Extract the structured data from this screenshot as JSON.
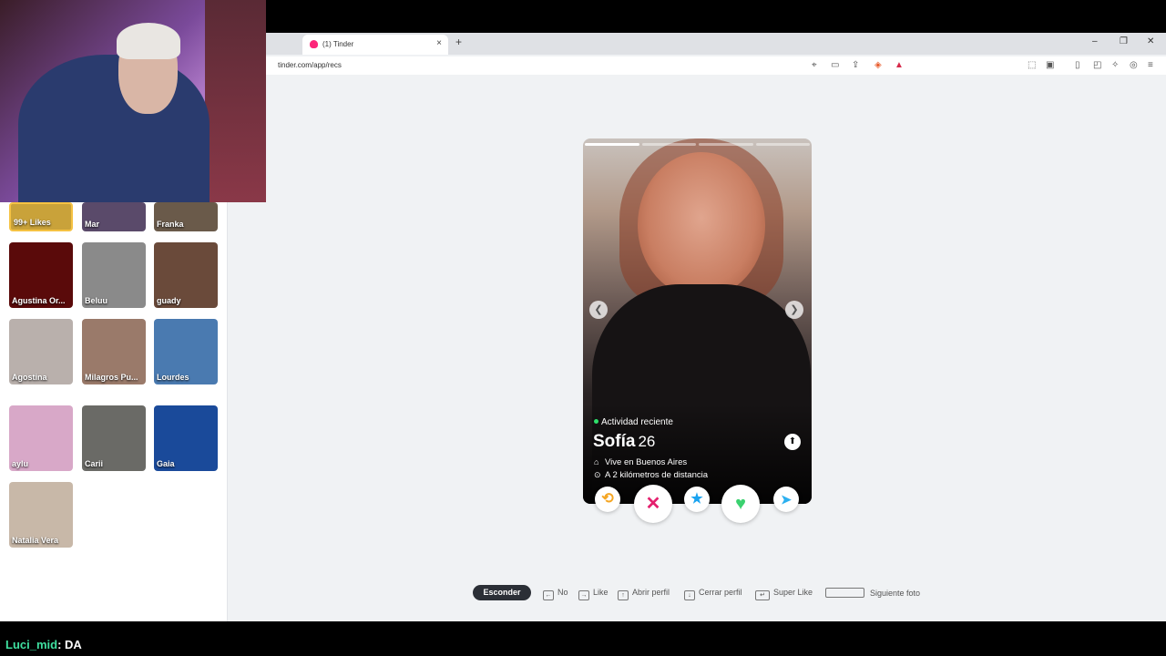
{
  "browser": {
    "tab_title": "(1) Tinder",
    "tab_close": "×",
    "new_tab": "+",
    "url": "tinder.com/app/recs",
    "window_controls": [
      "–",
      "❐",
      "✕"
    ]
  },
  "sidebar": {
    "items": [
      {
        "label": "99+ Likes",
        "color": "#c9a23a"
      },
      {
        "label": "Mar",
        "color": "#5a4a6a"
      },
      {
        "label": "Franka",
        "color": "#6a5a4a"
      },
      {
        "label": "Agustina Or...",
        "color": "#5a0a0a"
      },
      {
        "label": "Beluu",
        "color": "#8a8a8a"
      },
      {
        "label": "guady",
        "color": "#6a4a3a"
      },
      {
        "label": "Agostina",
        "color": "#b9b0ac"
      },
      {
        "label": "Milagros Pu...",
        "color": "#9a7a6a"
      },
      {
        "label": "Lourdes",
        "color": "#4a7ab0"
      },
      {
        "label": "aylu",
        "color": "#d8a8c8"
      },
      {
        "label": "Carii",
        "color": "#6a6a66"
      },
      {
        "label": "Gaia",
        "color": "#1a4a9a"
      },
      {
        "label": "Natalia Vera",
        "color": "#c8b8a8"
      }
    ]
  },
  "card": {
    "activity": "Actividad reciente",
    "name": "Sofía",
    "age": "26",
    "location": "Vive en Buenos Aires",
    "distance": "A 2 kilómetros de distancia",
    "photo_index": 1,
    "photo_count": 4
  },
  "actions": {
    "rewind": "⟲",
    "nope": "✕",
    "superlike": "★",
    "like": "♥",
    "boost": "➤"
  },
  "shortcuts": {
    "hide": "Esconder",
    "no": "No",
    "like": "Like",
    "open_profile": "Abrir perfil",
    "close_profile": "Cerrar perfil",
    "super_like": "Super Like",
    "next_photo": "Siguiente foto"
  },
  "chat": {
    "user": "Luci_mid",
    "message": ": DA"
  },
  "colors": {
    "brand": "#fd267a",
    "nope": "#e4206e",
    "superlike": "#1aa3f0",
    "like": "#3bd16f",
    "rewind": "#f5a623",
    "boost": "#2cb0f0"
  }
}
